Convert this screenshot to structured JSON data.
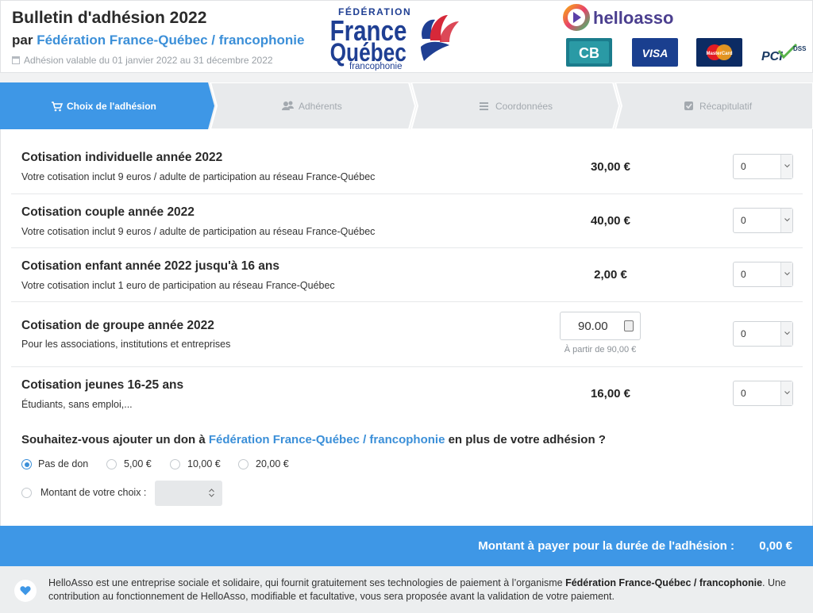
{
  "header": {
    "title": "Bulletin d'adhésion 2022",
    "by_prefix": "par ",
    "organization": "Fédération France-Québec / francophonie",
    "validity": "Adhésion valable du 01 janvier 2022 au 31 décembre 2022",
    "org_logo": {
      "line1": "FÉDÉRATION",
      "line2": "France",
      "line3": "Québec",
      "line4": "francophonie"
    },
    "brand": "helloasso",
    "payment_logos": [
      "CB",
      "VISA",
      "MasterCard",
      "PCI DSS"
    ]
  },
  "steps": [
    {
      "label": "Choix de l'adhésion",
      "icon": "cart-icon",
      "active": true
    },
    {
      "label": "Adhérents",
      "icon": "users-icon",
      "active": false
    },
    {
      "label": "Coordonnées",
      "icon": "list-icon",
      "active": false
    },
    {
      "label": "Récapitulatif",
      "icon": "check-square-icon",
      "active": false
    }
  ],
  "items": [
    {
      "title": "Cotisation individuelle année 2022",
      "desc": "Votre cotisation inclut 9 euros / adulte de participation au réseau France-Québec",
      "price": "30,00 €",
      "qty": "0"
    },
    {
      "title": "Cotisation couple année 2022",
      "desc": "Votre cotisation inclut 9 euros / adulte de participation au réseau France-Québec",
      "price": "40,00 €",
      "qty": "0"
    },
    {
      "title": "Cotisation enfant année 2022 jusqu'à 16 ans",
      "desc": "Votre cotisation inclut 1 euro de participation au réseau France-Québec",
      "price": "2,00 €",
      "qty": "0"
    },
    {
      "title": "Cotisation de groupe année 2022",
      "desc": "Pour les associations, institutions et entreprises",
      "amount": "90.00",
      "hint": "À partir de 90,00 €",
      "qty": "0"
    },
    {
      "title": "Cotisation jeunes 16-25 ans",
      "desc": "Étudiants, sans emploi,...",
      "price": "16,00 €",
      "qty": "0"
    }
  ],
  "donation": {
    "question_prefix": "Souhaitez-vous ajouter un don à ",
    "organization": "Fédération France-Québec / francophonie",
    "question_suffix": " en plus de votre adhésion ?",
    "options": [
      "Pas de don",
      "5,00 €",
      "10,00 €",
      "20,00 €"
    ],
    "selected": "Pas de don",
    "custom_label": "Montant de votre choix :",
    "custom_value": ""
  },
  "total": {
    "label": "Montant à payer pour la durée de l'adhésion :",
    "value": "0,00 €"
  },
  "footer": {
    "text_before": "HelloAsso est une entreprise sociale et solidaire, qui fournit gratuitement ses technologies de paiement à l’organisme ",
    "organization": "Fédération France-Québec / francophonie",
    "text_after": ". Une contribution au fonctionnement de HelloAsso, modifiable et facultative, vous sera proposée avant la validation de votre paiement."
  },
  "colors": {
    "accent": "#3e97e6",
    "link": "#3b8fd8",
    "step_inactive": "#e8eaec",
    "step_inactive_text": "#a3a9af"
  }
}
